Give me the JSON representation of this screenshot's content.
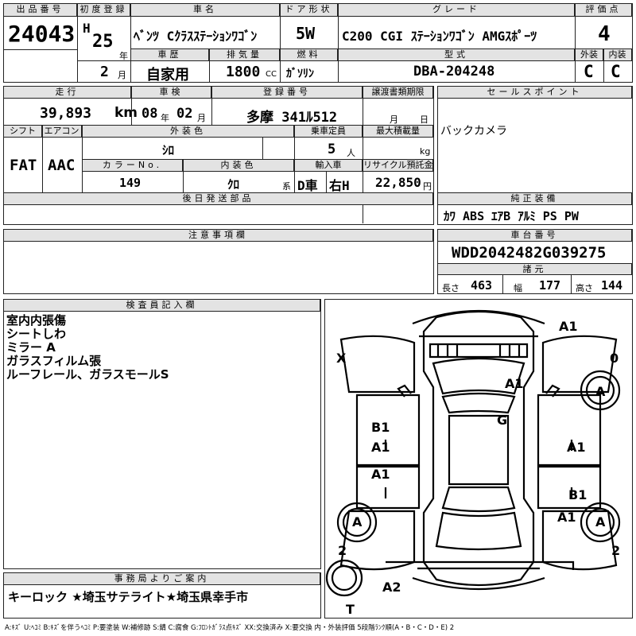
{
  "header": {
    "lot_label": "出品番号",
    "lot": "24043",
    "reg_label": "初度登録",
    "era": "H",
    "year": "25",
    "year_unit": "年",
    "month": "2",
    "month_unit": "月",
    "car_label": "車名",
    "car_name": "ﾍﾞﾝﾂ Cｸﾗｽｽﾃｰｼｮﾝﾜｺﾞﾝ",
    "door_label": "ドア形状",
    "door": "5W",
    "grade_label": "グレード",
    "grade": "C200 CGI ｽﾃｰｼｮﾝﾜｺﾞﾝ AMGｽﾎﾟｰﾂ",
    "score_label": "評価点",
    "score": "4",
    "history_label": "車歴",
    "history": "自家用",
    "disp_label": "排気量",
    "disp": "1800",
    "disp_unit": "CC",
    "fuel_label": "燃料",
    "fuel": "ｶﾞｿﾘﾝ",
    "model_label": "型式",
    "model": "DBA-204248",
    "ext_label": "外装",
    "ext": "C",
    "int_label": "内装",
    "int": "C"
  },
  "info": {
    "mileage_label": "走行",
    "mileage": "39,893",
    "mileage_unit": "km",
    "inspect_label": "車検",
    "inspect_y": "08",
    "inspect_y_unit": "年",
    "inspect_m": "02",
    "inspect_m_unit": "月",
    "plate_label": "登録番号",
    "plate": "多摩 341ﾙ512",
    "transfer_label": "譲渡書類期限",
    "transfer_m_unit": "月",
    "transfer_d_unit": "日",
    "shift_label": "シフト",
    "shift": "FAT",
    "ac_label": "エアコン",
    "ac": "AAC",
    "ext_color_label": "外装色",
    "ext_color": "ｼﾛ",
    "capacity_label": "乗車定員",
    "capacity": "5",
    "capacity_unit": "人",
    "load_label": "最大積載量",
    "load_unit": "kg",
    "color_no_label": "カラーNo.",
    "color_no": "149",
    "int_color_label": "内装色",
    "int_color": "ｸﾛ",
    "int_color_unit": "系",
    "import_label": "輸入車",
    "import": "D車",
    "handle": "右H",
    "recycle_label": "リサイクル預託金",
    "recycle": "22,850",
    "recycle_unit": "円",
    "later_label": "後日発送部品"
  },
  "sales": {
    "label": "セールスポイント",
    "text": "バックカメラ"
  },
  "equipment": {
    "label": "純正装備",
    "text": "ｶﾜ ABS ｴｱB ｱﾙﾐ PS PW"
  },
  "caution": {
    "label": "注意事項欄"
  },
  "chassis": {
    "label": "車台番号",
    "vin": "WDD2042482G039275",
    "spec_label": "諸元",
    "length_label": "長さ",
    "length": "463",
    "width_label": "幅",
    "width": "177",
    "height_label": "高さ",
    "height": "144"
  },
  "inspector": {
    "label": "検査員記入欄",
    "lines": [
      "室内内張傷",
      "シートしわ",
      "ミラー A",
      "ガラスフィルム張",
      "ルーフレール、ガラスモールS"
    ]
  },
  "office": {
    "label": "事務局よりご案内",
    "text": "キーロック ★埼玉サテライト★埼玉県幸手市"
  },
  "diagram": {
    "marks": {
      "top_right": "A1",
      "hood": "A1",
      "roof": "G",
      "left_b1": "B1",
      "left_a1": "A1",
      "left_a1_2": "A1",
      "right_a1": "A1",
      "right_b1": "B1",
      "right_a1_2": "A1",
      "wheel_fr": "A",
      "wheel_fl": "A",
      "wheel_rl": "A",
      "wheel_rr": "A",
      "rear": "A2",
      "lbl_x": "X",
      "lbl_o": "0",
      "lbl_2l": "2",
      "lbl_2r": "2",
      "lbl_t": "T"
    }
  },
  "legend": "A:ｷｽﾞ U:ﾍｺﾐ B:ｷｽﾞを伴うﾍｺﾐ P:要塗装 W:補修跡 S:錆 C:腐食 G:ﾌﾛﾝﾄｶﾞﾗｽ点ｷｽﾞ XX:交換済み X:要交換 内・外装評価 5段階ﾗﾝｸ順(A・B・C・D・E) 2"
}
